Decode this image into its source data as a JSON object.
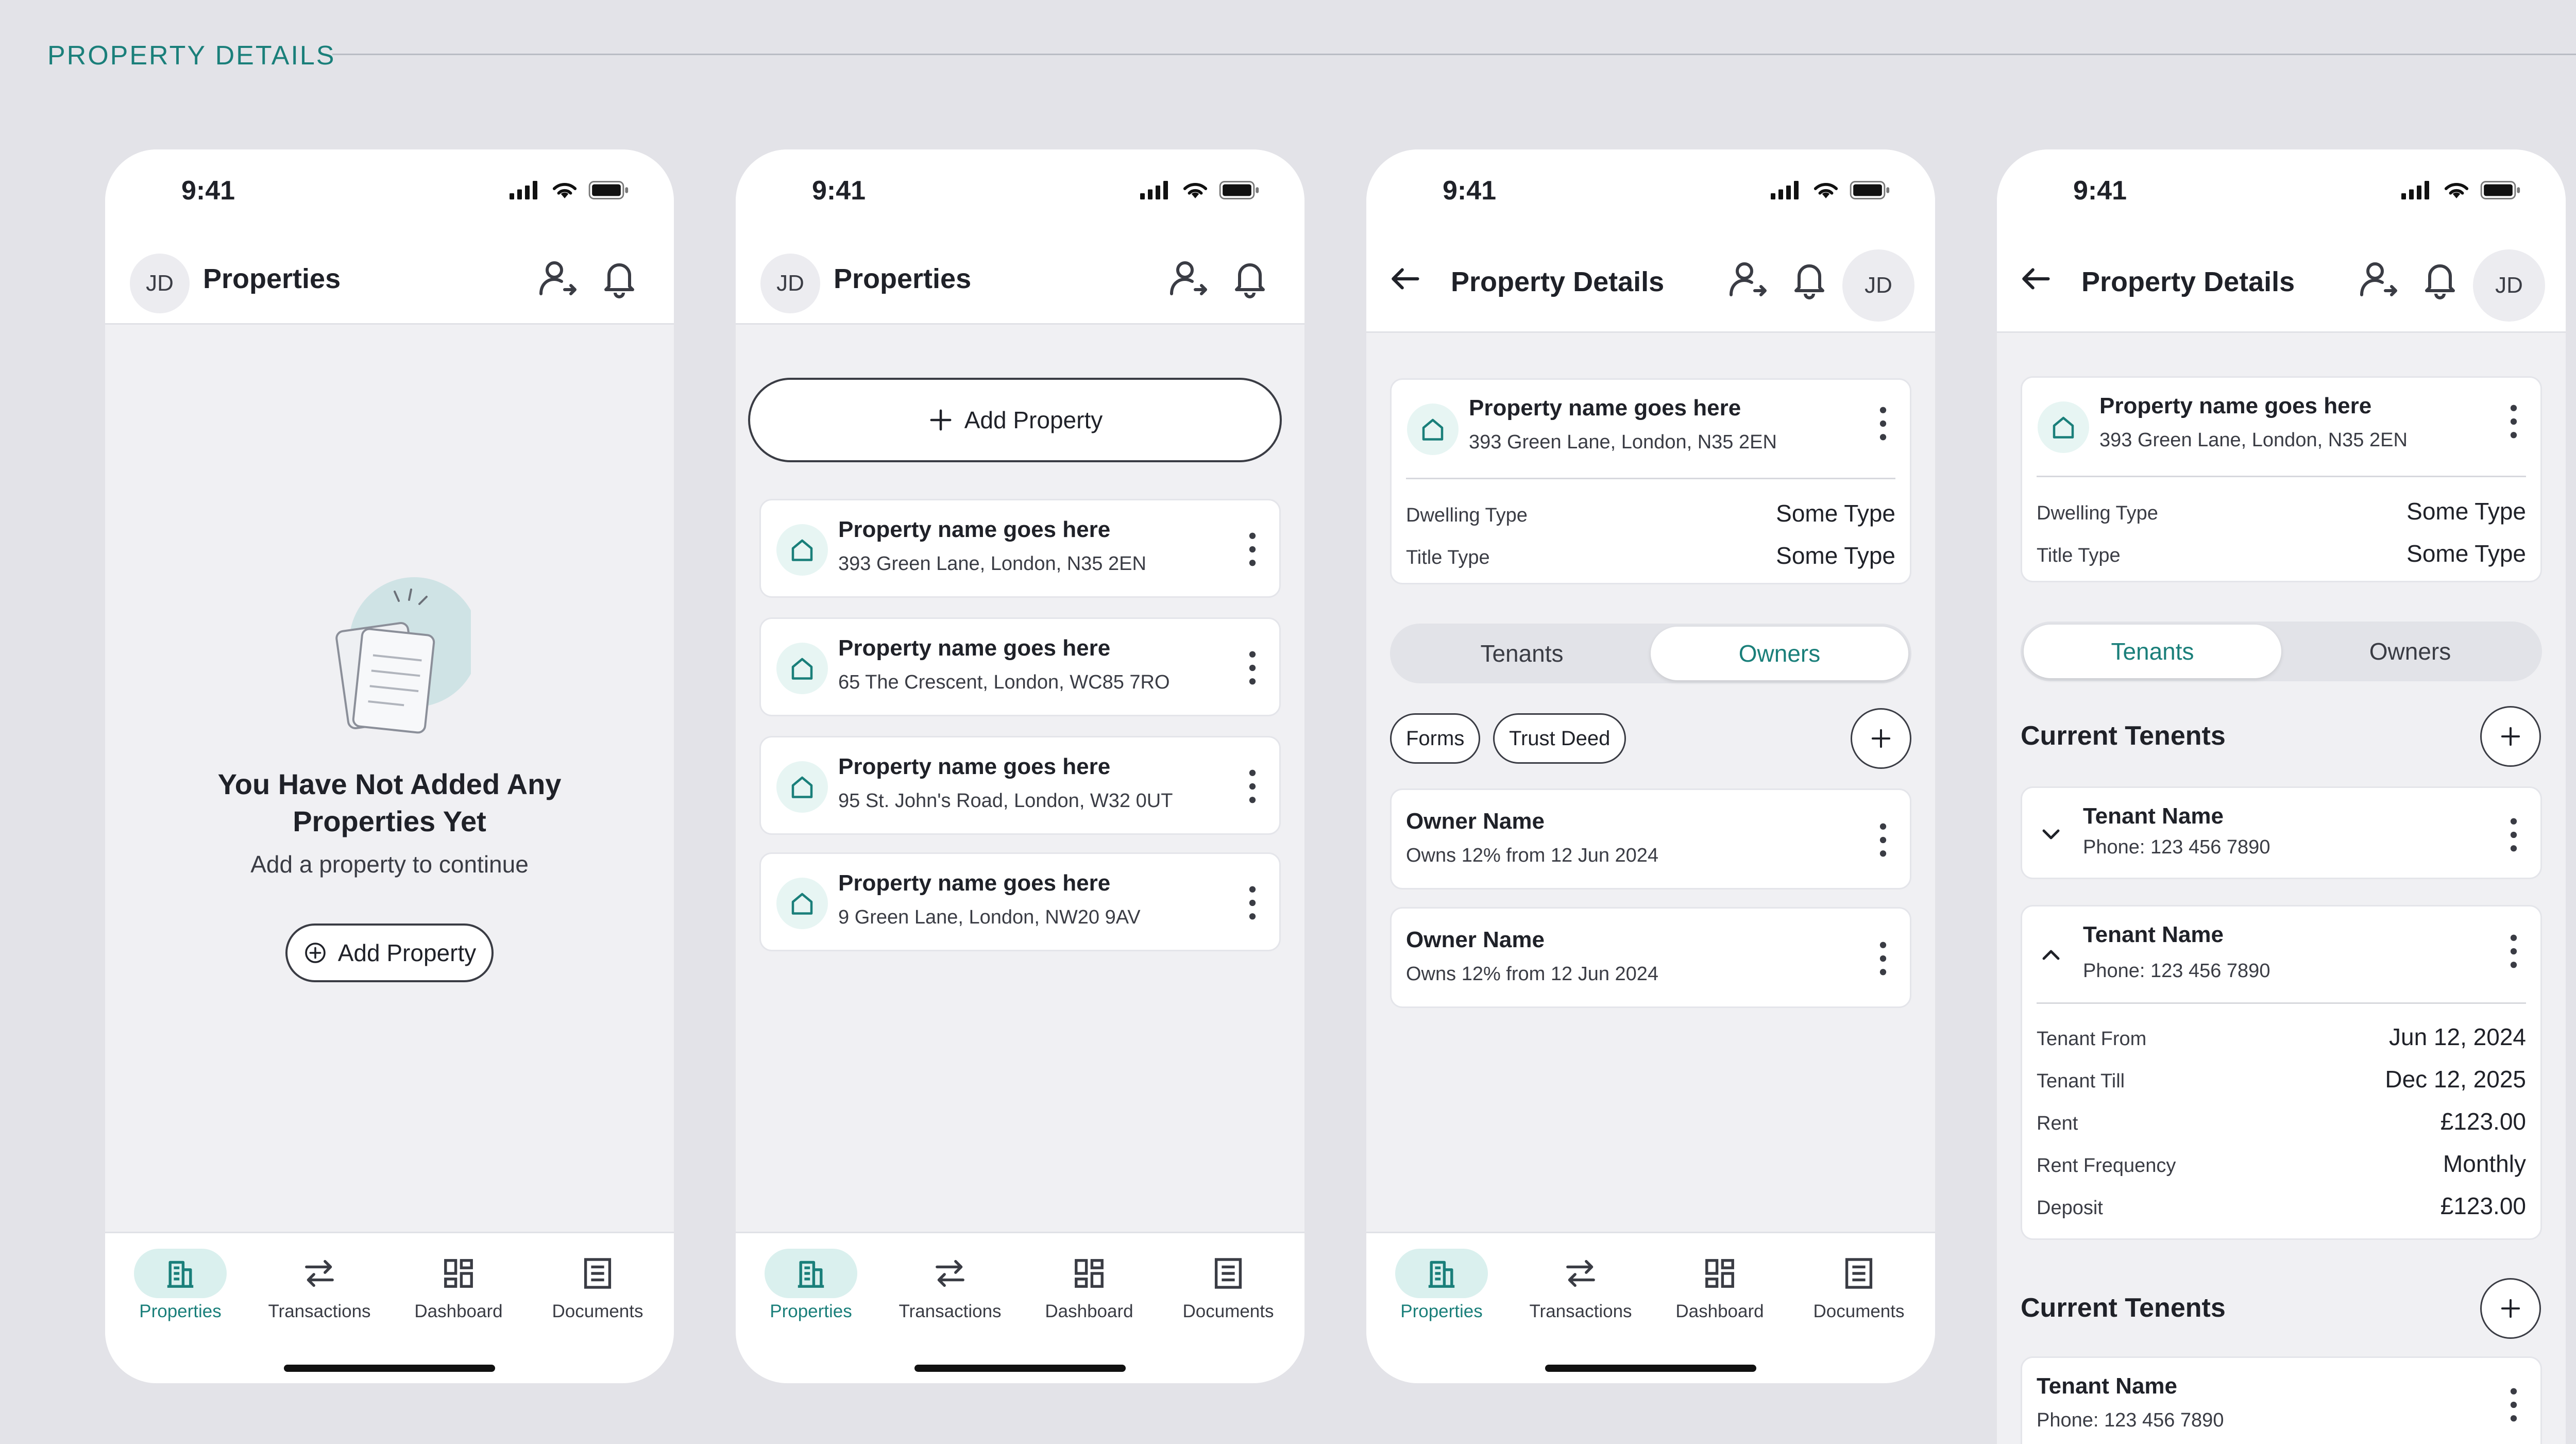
{
  "page": {
    "title": "PROPERTY DETAILS"
  },
  "status": {
    "time": "9:41"
  },
  "nav": [
    {
      "label": "Properties",
      "icon": "building-icon"
    },
    {
      "label": "Transactions",
      "icon": "swap-arrows-icon"
    },
    {
      "label": "Dashboard",
      "icon": "grid-dashboard-icon"
    },
    {
      "label": "Documents",
      "icon": "document-icon"
    }
  ],
  "avatar_initials": "JD",
  "screen1": {
    "title": "Properties",
    "empty_title": "You Have Not Added Any Properties Yet",
    "empty_sub": "Add a property to continue",
    "add_label": "Add Property"
  },
  "screen2": {
    "title": "Properties",
    "add_label": "Add Property",
    "properties": [
      {
        "name": "Property name goes here",
        "address": "393 Green Lane, London, N35 2EN"
      },
      {
        "name": "Property name goes here",
        "address": "65 The Crescent, London, WC85 7RO"
      },
      {
        "name": "Property name goes here",
        "address": "95 St. John's Road, London, W32 0UT"
      },
      {
        "name": "Property name goes here",
        "address": "9 Green Lane, London, NW20 9AV"
      }
    ]
  },
  "screen3": {
    "title": "Property Details",
    "property": {
      "name": "Property name goes here",
      "address": "393 Green Lane, London, N35 2EN"
    },
    "details": [
      {
        "key": "Dwelling Type",
        "value": "Some Type"
      },
      {
        "key": "Title Type",
        "value": "Some Type"
      }
    ],
    "segments": [
      "Tenants",
      "Owners"
    ],
    "active_segment": "Owners",
    "chips": [
      "Forms",
      "Trust Deed"
    ],
    "owners": [
      {
        "name": "Owner Name",
        "sub": "Owns 12% from 12 Jun 2024"
      },
      {
        "name": "Owner Name",
        "sub": "Owns 12% from 12 Jun 2024"
      }
    ]
  },
  "screen4": {
    "title": "Property Details",
    "property": {
      "name": "Property name goes here",
      "address": "393 Green Lane, London, N35 2EN"
    },
    "details": [
      {
        "key": "Dwelling Type",
        "value": "Some Type"
      },
      {
        "key": "Title Type",
        "value": "Some Type"
      }
    ],
    "segments": [
      "Tenants",
      "Owners"
    ],
    "active_segment": "Tenants",
    "section1_title": "Current Tenents",
    "section2_title": "Current Tenents",
    "tenants": [
      {
        "name": "Tenant Name",
        "phone": "Phone: 123 456 7890"
      },
      {
        "name": "Tenant Name",
        "phone": "Phone: 123 456 7890"
      },
      {
        "name": "Tenant Name",
        "phone": "Phone: 123 456 7890"
      }
    ],
    "tenant_details": [
      {
        "key": "Tenant From",
        "value": "Jun 12, 2024"
      },
      {
        "key": "Tenant Till",
        "value": "Dec 12, 2025"
      },
      {
        "key": "Rent",
        "value": "£123.00"
      },
      {
        "key": "Rent Frequency",
        "value": "Monthly"
      },
      {
        "key": "Deposit",
        "value": "£123.00"
      }
    ]
  },
  "colors": {
    "accent": "#1a7f7a",
    "background": "#e3e3e8",
    "surface": "#ffffff",
    "accent_tint": "#daf0ee"
  }
}
